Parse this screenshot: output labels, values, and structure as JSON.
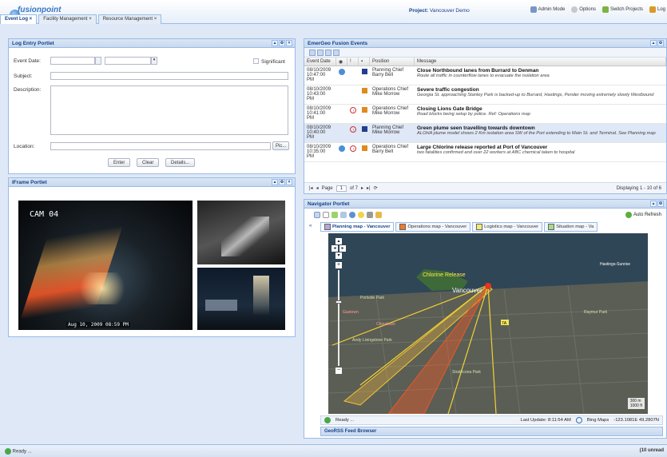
{
  "app": {
    "name": "fusionpoint",
    "project_label": "Project:",
    "project_name": "Vancouver Demo"
  },
  "top_menu": [
    "Admin Mode",
    "Options",
    "Switch Projects",
    "Log"
  ],
  "tabs": [
    "Event Log",
    "Facility Management",
    "Resource Management"
  ],
  "log_entry": {
    "title": "Log Entry Portlet",
    "event_date_label": "Event Date:",
    "significant_label": "Significant",
    "subject_label": "Subject:",
    "description_label": "Description:",
    "location_label": "Location:",
    "pick_label": "Pic...",
    "buttons": [
      "Enter",
      "Clear",
      "Details..."
    ]
  },
  "iframe": {
    "title": "IFrame Portlet",
    "cam_label": "CAM 04",
    "cam_timestamp": "Aug 10, 2009 08:59 PM"
  },
  "events": {
    "title": "EmerGeo Fusion Events",
    "columns": [
      "Event Date",
      "Position",
      "Message"
    ],
    "rows": [
      {
        "date": "08/10/2009",
        "time": "10:47:00 PM",
        "pos1": "Planning Chief",
        "pos2": "Barry Bell",
        "msg": "Close Northbound lanes from Burrard to Denman",
        "detail": "Route all traffic in counterflow lanes to evacuate the isolation area",
        "dot": "#4a8fd8",
        "warn": false,
        "sq": "#243d8f"
      },
      {
        "date": "08/10/2009",
        "time": "10:43:00 PM",
        "pos1": "Operations Chief",
        "pos2": "Mike Morrow",
        "msg": "Severe traffic congestion",
        "detail": "Georgia St. approaching Stanley Park is backed-up to Burrard, Hastings, Pender moving extremely slowly Westbound",
        "dot": "",
        "warn": false,
        "sq": "#e08a1e"
      },
      {
        "date": "08/10/2009",
        "time": "10:41:00 PM",
        "pos1": "Operations Chief",
        "pos2": "Mike Morrow",
        "msg": "Closing Lions Gate Bridge",
        "detail": "Road blocks being setup by police. Ref: Operations map",
        "dot": "",
        "warn": true,
        "sq": "#e08a1e"
      },
      {
        "date": "08/10/2009",
        "time": "10:40:00 PM",
        "pos1": "Planning Chief",
        "pos2": "Mike Morrow",
        "msg": "Green plume seen travelling towards downtown",
        "detail": "ALOHA plume model shows 2 Km isolation area SW of the Port extending to Main St. and Terminal. See Planning map",
        "dot": "",
        "warn": true,
        "sq": "#243d8f"
      },
      {
        "date": "08/10/2009",
        "time": "10:35:00 PM",
        "pos1": "Operations Chief",
        "pos2": "Barry Bell",
        "msg": "Large Chlorine release reported at Port of Vancouver",
        "detail": "two fatalities confirmed and over 22 workers at ABC chemical taken to hospital",
        "dot": "#4a8fd8",
        "warn": true,
        "sq": "#e08a1e"
      }
    ],
    "pager": {
      "page_label": "Page",
      "page": "1",
      "of": "of 7",
      "display": "Displaying 1 - 10 of 6"
    }
  },
  "navigator": {
    "title": "Navigator Portlet",
    "auto_refresh": "Auto Refresh",
    "map_tabs": [
      {
        "label": "Planning map - Vancouver",
        "color": "#b8a6d8"
      },
      {
        "label": "Operations map - Vancouver",
        "color": "#ef7a2a"
      },
      {
        "label": "Logistics map - Vancouver",
        "color": "#f3ea74"
      },
      {
        "label": "Situation map - Va",
        "color": "#a7d98a"
      }
    ],
    "map_labels": {
      "release": "Chlorine Release",
      "city": "Vancouver",
      "park": "Portside Park",
      "area1": "Gastown",
      "area2": "Chinatown",
      "area3": "Andy Livingstone Park",
      "area4": "Strathcona Park",
      "area5": "Raymur Park",
      "area6": "Hastings-Sunrise",
      "road": "7A"
    },
    "scale": [
      "300 m",
      "1000 ft"
    ],
    "status": "Ready ...",
    "last_update": "Last Update: 8:11:54 AM",
    "provider": "Bing Maps",
    "coords": "-123.1081E 49.2807N"
  },
  "georss": {
    "title": "GeoRSS Feed Browser"
  },
  "status": {
    "left": "Ready ...",
    "right": "(10 unread"
  }
}
